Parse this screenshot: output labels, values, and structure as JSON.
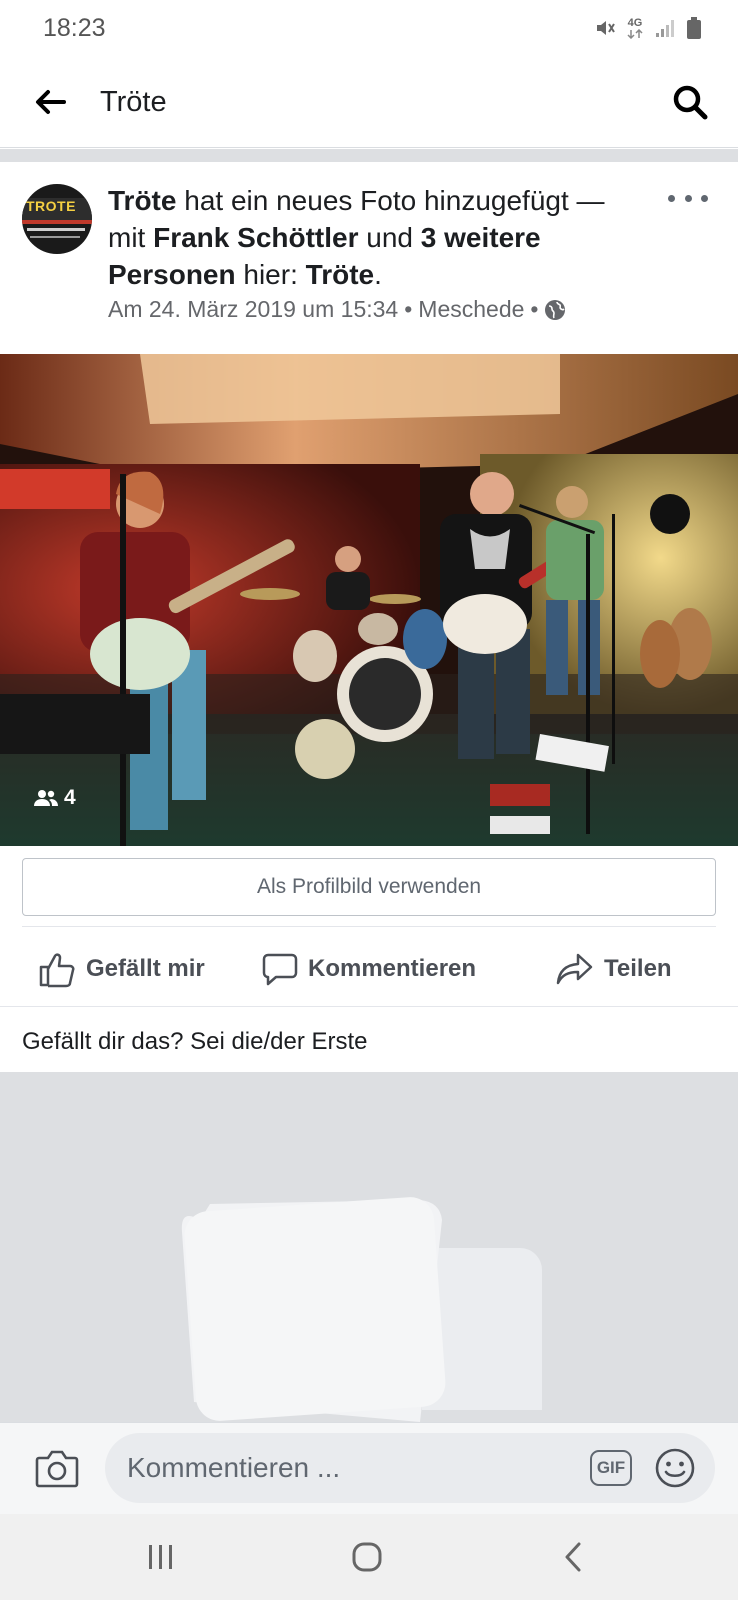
{
  "status_bar": {
    "time": "18:23",
    "network": "4G"
  },
  "header": {
    "title": "Tröte",
    "back_icon": "arrow-left-icon",
    "search_icon": "search-icon"
  },
  "post": {
    "actor": "Tröte",
    "action_text": " hat ein neues Foto hinzugefügt — mit ",
    "tagged_person": "Frank Schöttler",
    "and_text": " und ",
    "others": "3 weitere Personen",
    "location_prefix": " hier: ",
    "location": "Tröte",
    "period": ".",
    "date": "Am 24. März 2019 um 15:34",
    "separator": "•",
    "place": "Meschede",
    "privacy_icon": "globe-icon",
    "avatar_label": "TROTE",
    "photo_tag_count": "4"
  },
  "profile_button": "Als Profilbild verwenden",
  "actions": {
    "like": "Gefällt mir",
    "comment": "Kommentieren",
    "share": "Teilen"
  },
  "likes_prompt": "Gefällt dir das? Sei die/der Erste",
  "composer": {
    "placeholder": "Kommentieren ...",
    "gif_label": "GIF"
  },
  "colors": {
    "text": "#1c1e21",
    "secondary": "#65676b",
    "divider": "#dddfe2"
  }
}
